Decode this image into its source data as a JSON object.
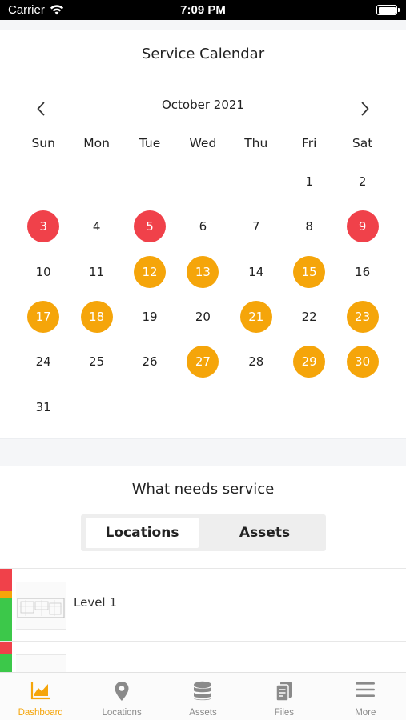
{
  "status_bar": {
    "carrier": "Carrier",
    "time": "7:09 PM"
  },
  "calendar": {
    "title": "Service Calendar",
    "month": "October 2021",
    "weekdays": [
      "Sun",
      "Mon",
      "Tue",
      "Wed",
      "Thu",
      "Fri",
      "Sat"
    ],
    "first_weekday_index": 5,
    "days_in_month": 31,
    "day_status": {
      "3": "red",
      "5": "red",
      "9": "red",
      "12": "orange",
      "13": "orange",
      "15": "orange",
      "17": "orange",
      "18": "orange",
      "21": "orange",
      "23": "orange",
      "27": "orange",
      "29": "orange",
      "30": "orange"
    },
    "colors": {
      "red": "#f0414a",
      "orange": "#f5a50a"
    },
    "icons": {
      "prev": "chevron-left-icon",
      "next": "chevron-right-icon"
    }
  },
  "service": {
    "title": "What needs service",
    "tabs": [
      {
        "label": "Locations",
        "selected": true
      },
      {
        "label": "Assets",
        "selected": false
      }
    ],
    "locations": [
      {
        "label": "Level 1",
        "status_colors": [
          "#f0414a",
          "#f5a50a",
          "#3cc84a"
        ]
      },
      {
        "label": "",
        "status_colors": [
          "#f0414a",
          "#3cc84a"
        ]
      }
    ]
  },
  "tabbar": {
    "accent": "#f5a50a",
    "items": [
      {
        "label": "Dashboard",
        "icon": "chart-icon",
        "active": true
      },
      {
        "label": "Locations",
        "icon": "map-pin-icon",
        "active": false
      },
      {
        "label": "Assets",
        "icon": "database-icon",
        "active": false
      },
      {
        "label": "Files",
        "icon": "files-icon",
        "active": false
      },
      {
        "label": "More",
        "icon": "menu-icon",
        "active": false
      }
    ]
  }
}
